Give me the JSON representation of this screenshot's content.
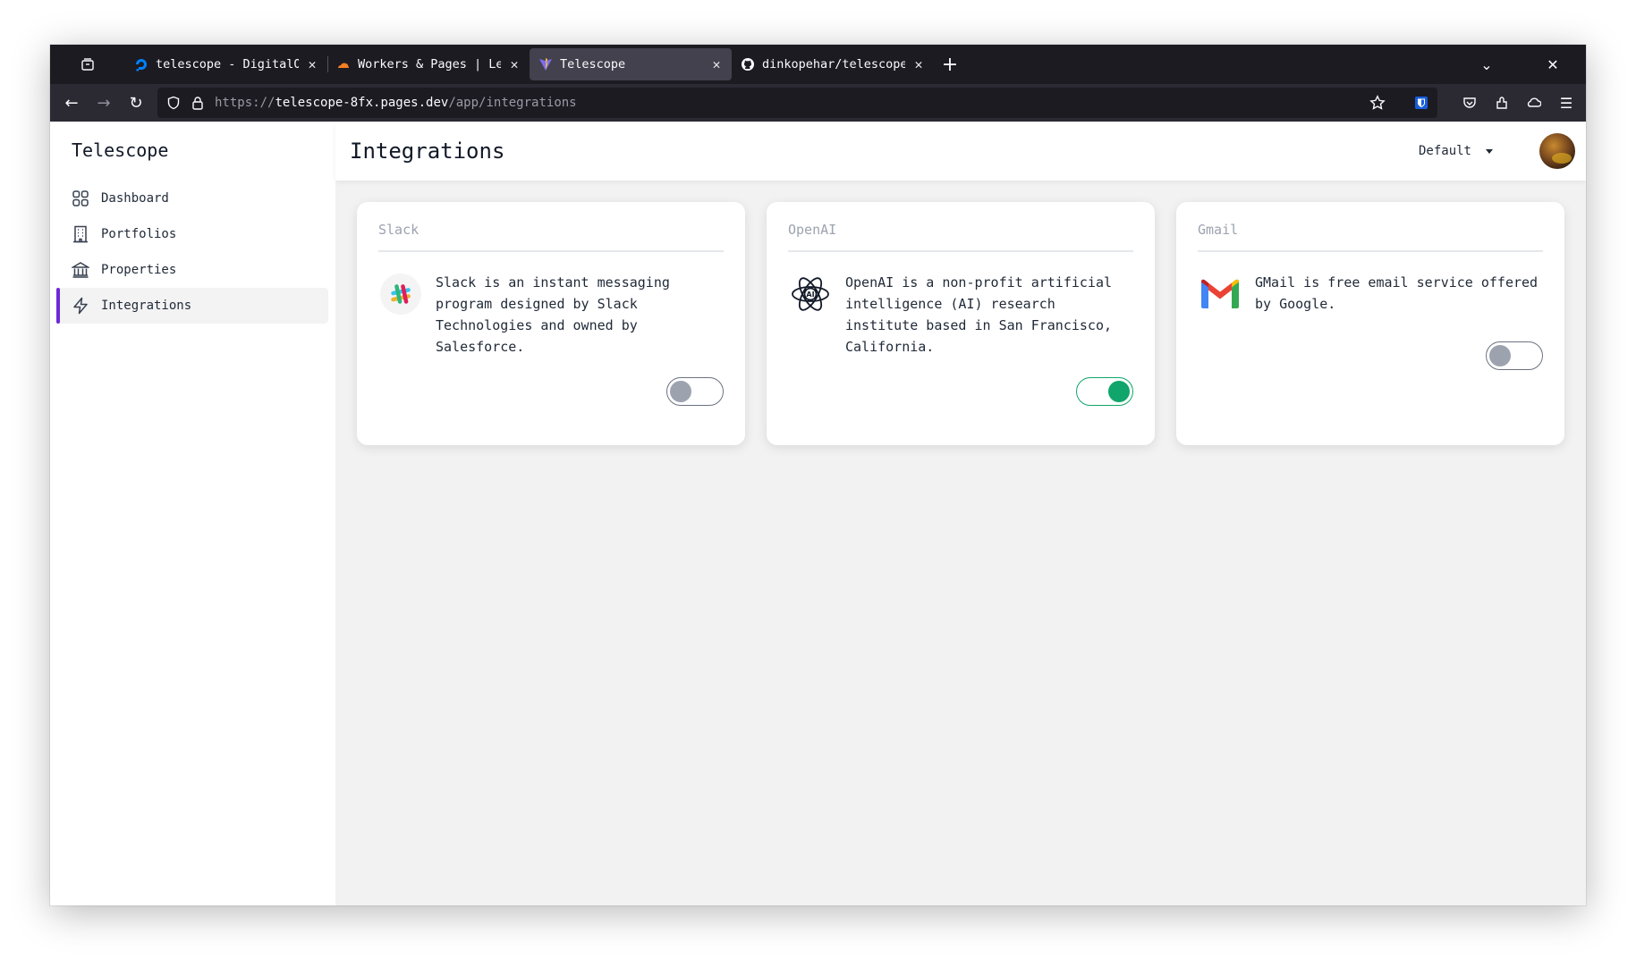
{
  "browser": {
    "tabs": [
      {
        "title": "telescope - DigitalOce",
        "favicon": "digitalocean-icon",
        "active": false
      },
      {
        "title": "Workers & Pages | Lemo",
        "favicon": "cloudflare-icon",
        "active": false
      },
      {
        "title": "Telescope",
        "favicon": "vite-icon",
        "active": true
      },
      {
        "title": "dinkopehar/telescope:",
        "favicon": "github-icon",
        "active": false
      }
    ],
    "url": {
      "scheme": "https://",
      "host": "telescope-8fx.pages.dev",
      "path": "/app/integrations"
    }
  },
  "sidebar": {
    "title": "Telescope",
    "items": [
      {
        "label": "Dashboard",
        "icon": "grid-icon",
        "active": false
      },
      {
        "label": "Portfolios",
        "icon": "building-icon",
        "active": false
      },
      {
        "label": "Properties",
        "icon": "bank-icon",
        "active": false
      },
      {
        "label": "Integrations",
        "icon": "bolt-icon",
        "active": true
      }
    ]
  },
  "header": {
    "title": "Integrations",
    "profile_select": "Default"
  },
  "integrations": [
    {
      "name": "Slack",
      "description": "Slack is an instant messaging program designed by Slack Technologies and owned by Salesforce.",
      "logo": "slack-logo",
      "enabled": false
    },
    {
      "name": "OpenAI",
      "description": "OpenAI is a non-profit artificial intelligence (AI) research institute based in San Francisco, California.",
      "logo": "openai-logo",
      "enabled": true
    },
    {
      "name": "Gmail",
      "description": "GMail is free email service offered by Google.",
      "logo": "gmail-logo",
      "enabled": false
    }
  ],
  "colors": {
    "accent": "#6d28d9",
    "toggle_on": "#10a56a",
    "toggle_off": "#9ca3af"
  }
}
